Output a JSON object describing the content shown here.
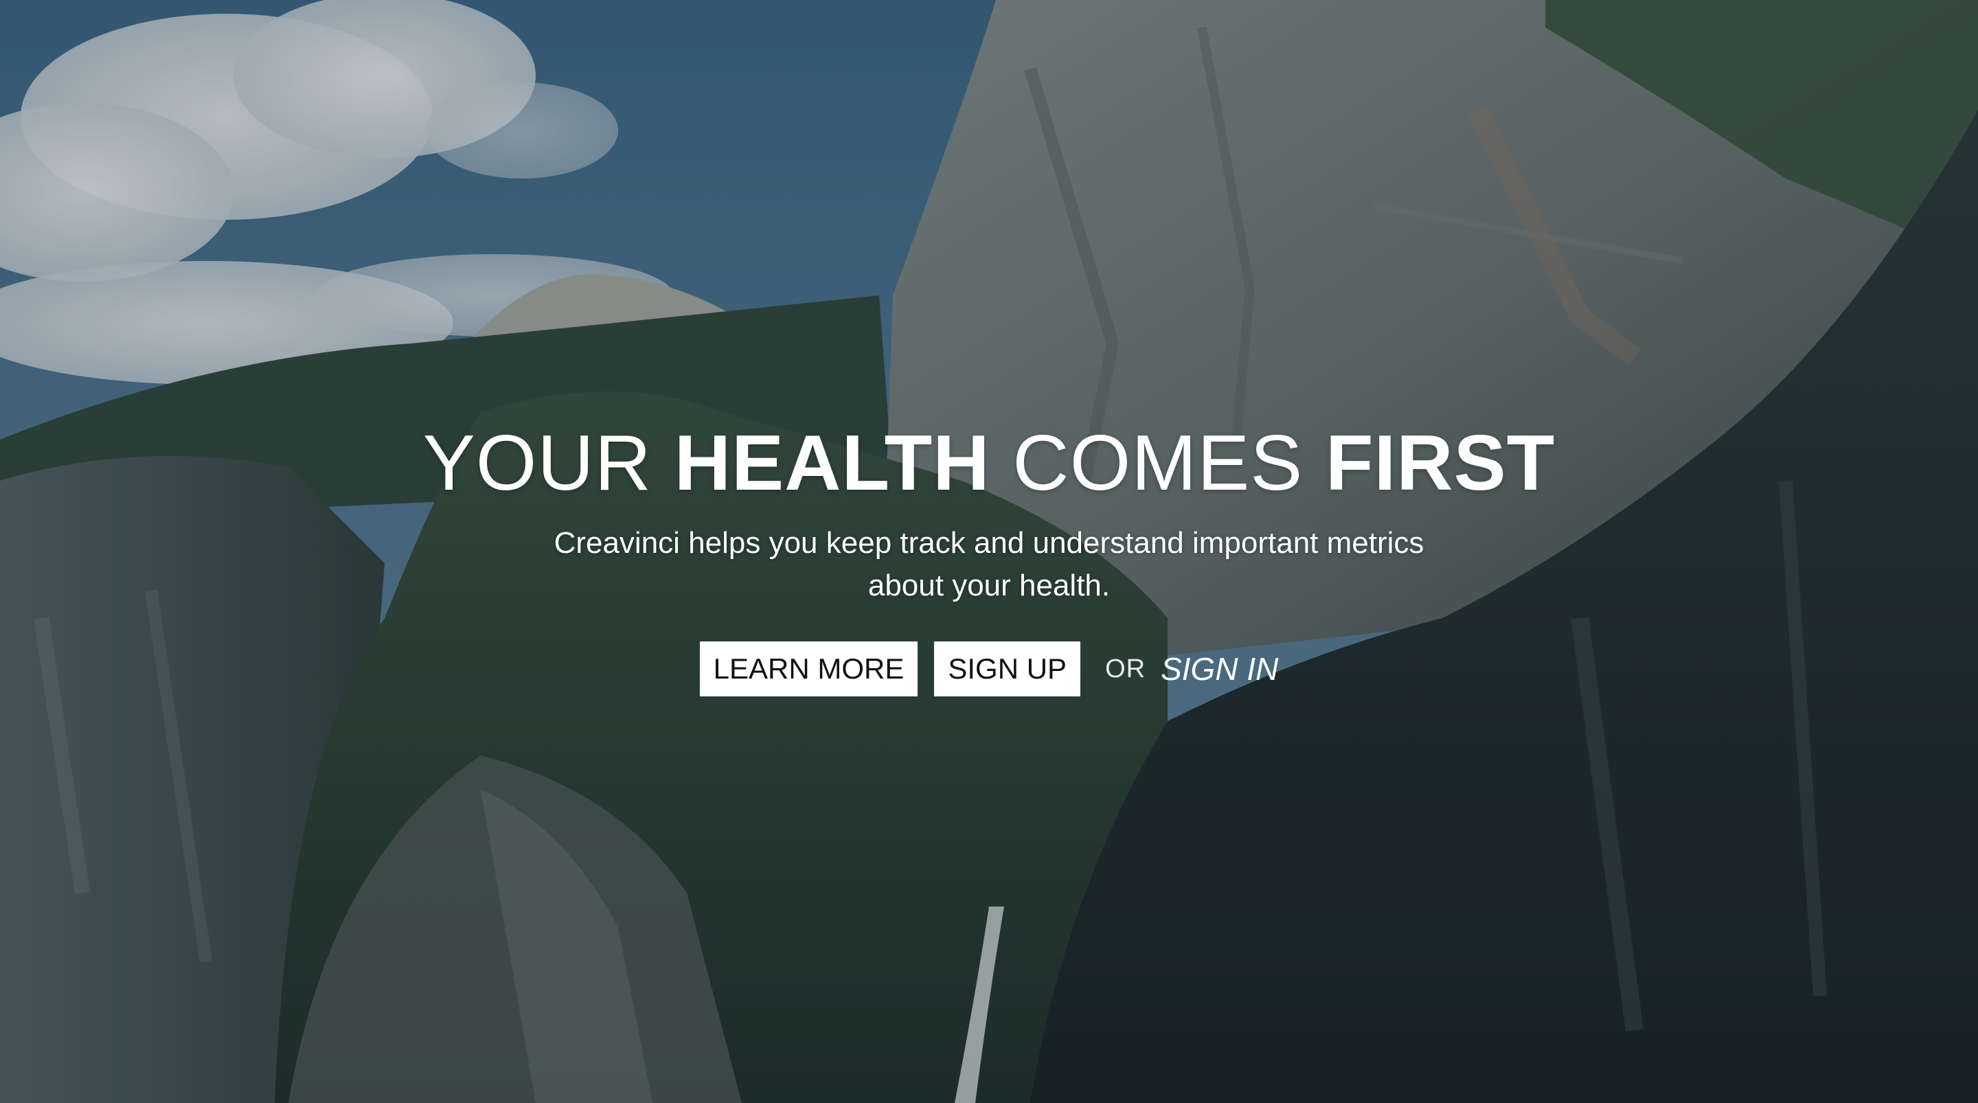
{
  "hero": {
    "headline_light_1": "YOUR ",
    "headline_bold_1": "HEALTH",
    "headline_light_2": " COMES ",
    "headline_bold_2": "FIRST",
    "subtitle_line_1": "Creavinci helps you keep track and understand important metrics",
    "subtitle_line_2": "about your health.",
    "learn_more_label": "LEARN MORE",
    "sign_up_label": "SIGN UP",
    "or_label": "OR",
    "sign_in_label": "SIGN IN",
    "background": "mountain-valley-photo"
  },
  "colors": {
    "sky": "#4a7390",
    "button_bg": "#ffffff",
    "button_text": "#111111",
    "text": "#ffffff"
  }
}
